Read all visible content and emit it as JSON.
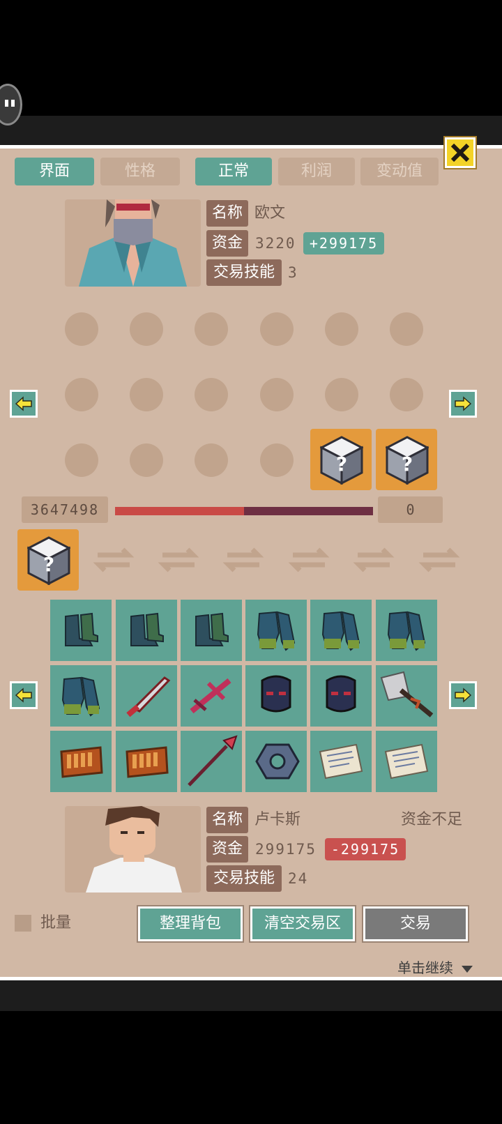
{
  "tabs": [
    {
      "label": "界面",
      "active": true
    },
    {
      "label": "性格",
      "active": false
    },
    {
      "label": "正常",
      "active": true
    },
    {
      "label": "利润",
      "active": false
    },
    {
      "label": "变动值",
      "active": false
    }
  ],
  "merchant": {
    "name_label": "名称",
    "name": "欧文",
    "funds_label": "资金",
    "funds": "3220",
    "funds_delta": "+299175",
    "skill_label": "交易技能",
    "skill": "3"
  },
  "trade_bar": {
    "left_value": "3647498",
    "right_value": "0",
    "fill_fraction": 0.5
  },
  "player": {
    "name_label": "名称",
    "name": "卢卡斯",
    "warning": "资金不足",
    "funds_label": "资金",
    "funds": "299175",
    "funds_delta": "-299175",
    "skill_label": "交易技能",
    "skill": "24"
  },
  "inventory": {
    "rows": [
      [
        "boots-icon",
        "boots-icon",
        "boots-icon",
        "gauntlets-icon",
        "gauntlets-icon",
        "gauntlets-icon"
      ],
      [
        "gauntlets-icon",
        "red-blade-icon",
        "crossbow-icon",
        "dark-mask-icon",
        "dark-mask-icon",
        "axe-icon"
      ],
      [
        "ammo-belt-icon",
        "ammo-belt-icon",
        "spear-icon",
        "hex-nut-icon",
        "paper-note-icon",
        "paper-note-icon"
      ]
    ]
  },
  "footer": {
    "batch_label": "批量",
    "sort_label": "整理背包",
    "clear_label": "清空交易区",
    "trade_label": "交易",
    "continue_label": "单击继续"
  },
  "colors": {
    "accent": "#5fa394",
    "gain": "#5fa394",
    "loss": "#c9514f",
    "panel": "#d1b8a5"
  }
}
